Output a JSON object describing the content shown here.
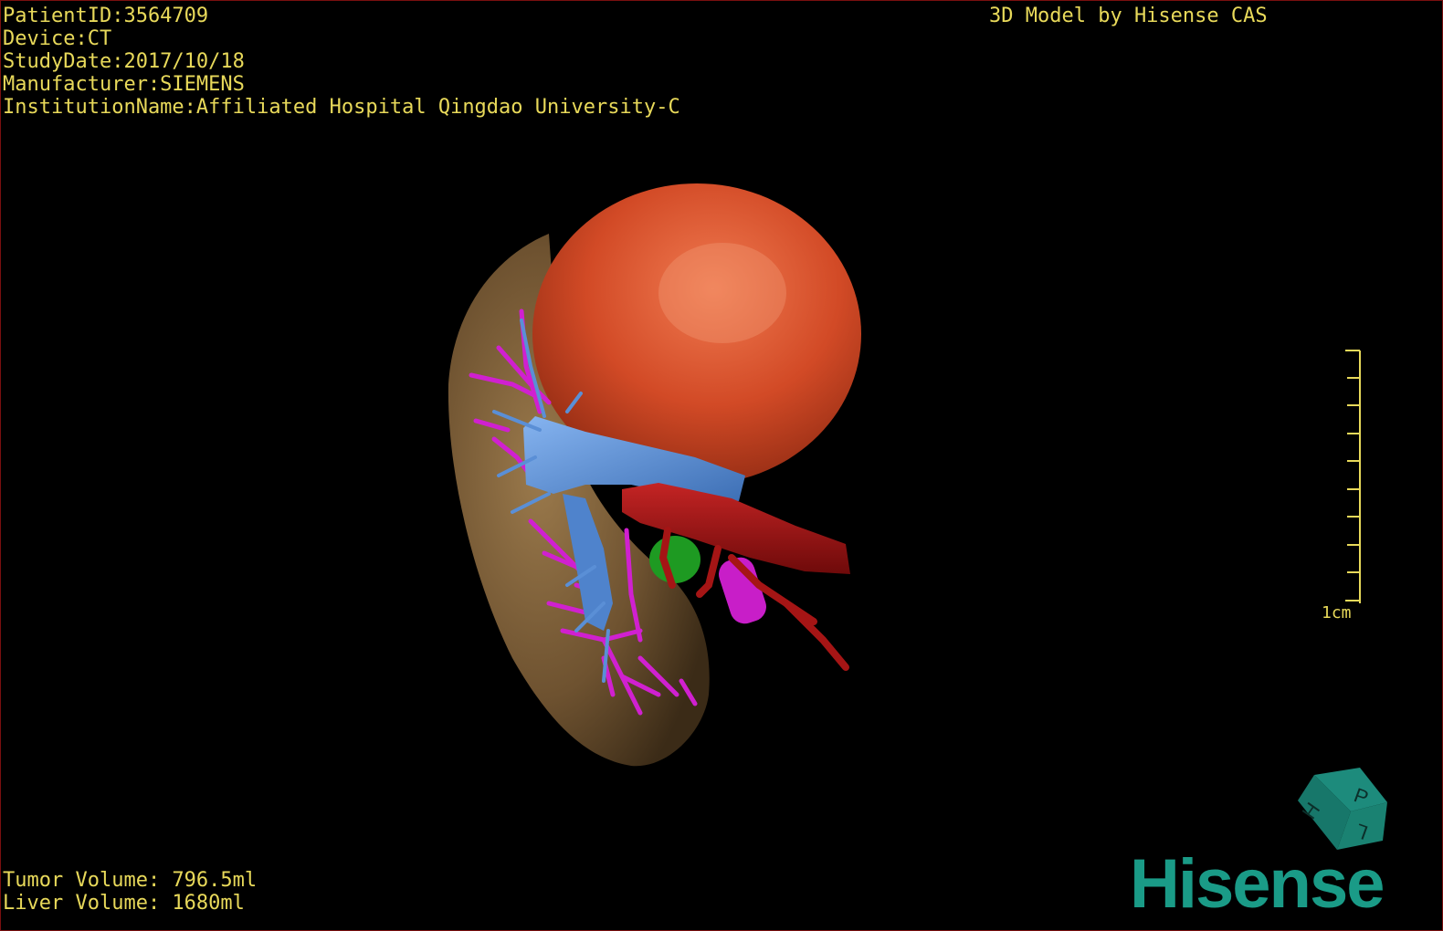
{
  "overlay": {
    "patient_id": "PatientID:3564709",
    "device": "Device:CT",
    "study_date": "StudyDate:2017/10/18",
    "manufacturer": "Manufacturer:SIEMENS",
    "institution": "InstitutionName:Affiliated Hospital Qingdao University-C",
    "vendor_label": "3D Model by Hisense CAS",
    "tumor_volume": "Tumor Volume: 796.5ml",
    "liver_volume": "Liver Volume: 1680ml",
    "scale_label": "1cm",
    "logo_text": "Hisense"
  },
  "orientation_cube": {
    "letters": [
      "H",
      "P",
      "L"
    ]
  },
  "colors": {
    "text": "#e8d95a",
    "liver": "#7a5a34",
    "tumor": "#d84a28",
    "portal_vein": "#5a8fd6",
    "hepatic_vein": "#d020d0",
    "artery": "#a51515",
    "gallbladder": "#1e9a22",
    "logo": "#1a9b87"
  }
}
